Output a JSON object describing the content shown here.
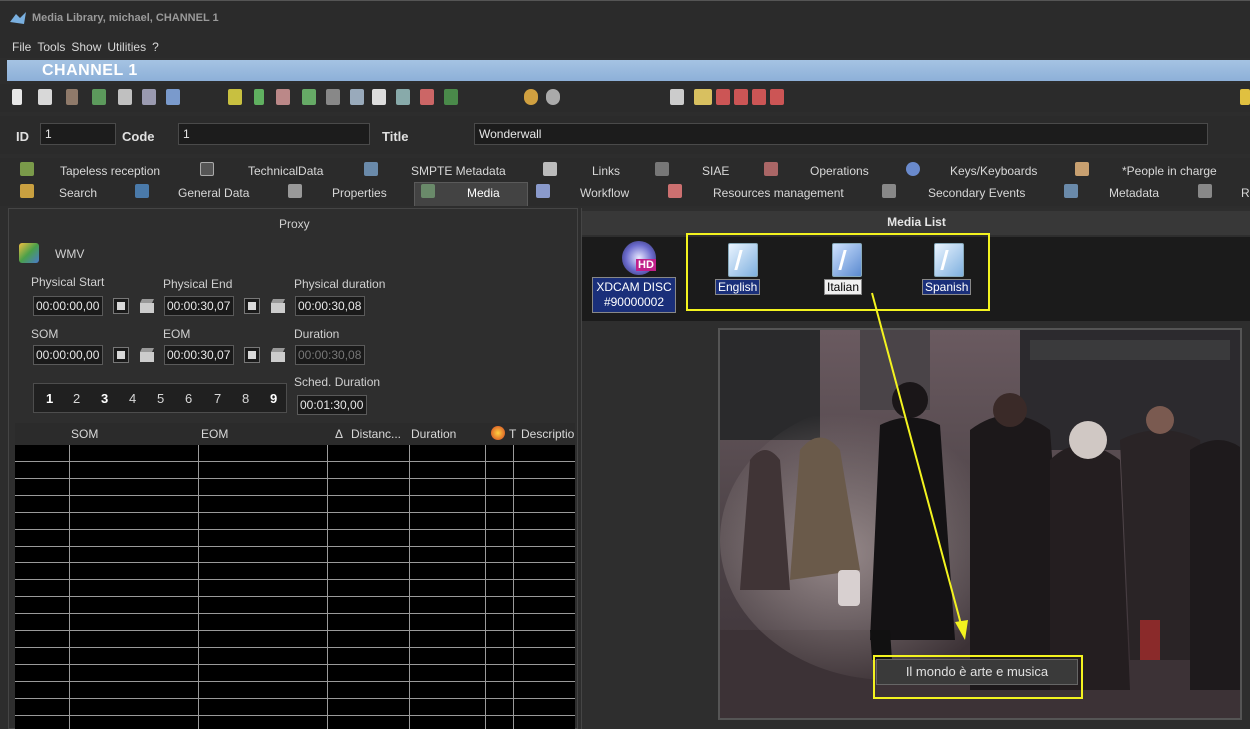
{
  "window": {
    "title": "Media Library, michael, CHANNEL 1"
  },
  "menu": [
    "File",
    "Tools",
    "Show",
    "Utilities",
    "?"
  ],
  "channel": "CHANNEL 1",
  "fields": {
    "id_label": "ID",
    "id_value": "1",
    "code_label": "Code",
    "code_value": "1",
    "title_label": "Title",
    "title_value": "Wonderwall"
  },
  "tabs_row1": [
    "Tapeless reception",
    "TechnicalData",
    "SMPTE Metadata",
    "Links",
    "SIAE",
    "Operations",
    "Keys/Keyboards",
    "*People in charge"
  ],
  "tabs_row2": [
    "Search",
    "General Data",
    "Properties",
    "Media",
    "Workflow",
    "Resources management",
    "Secondary Events",
    "Metadata",
    "R"
  ],
  "proxy": {
    "header": "Proxy",
    "format": "WMV",
    "physical_start_label": "Physical Start",
    "physical_start": "00:00:00,00",
    "physical_end_label": "Physical End",
    "physical_end": "00:00:30,07",
    "physical_duration_label": "Physical duration",
    "physical_duration": "00:00:30,08",
    "som_label": "SOM",
    "som": "00:00:00,00",
    "eom_label": "EOM",
    "eom": "00:00:30,07",
    "duration_label": "Duration",
    "duration": "00:00:30,08",
    "sched_duration_label": "Sched. Duration",
    "sched_duration": "00:01:30,00",
    "pages": [
      "1",
      "2",
      "3",
      "4",
      "5",
      "6",
      "7",
      "8",
      "9"
    ]
  },
  "grid": {
    "columns": [
      "SOM",
      "EOM",
      "Distanc...",
      "Duration",
      "T",
      "Descriptio"
    ],
    "sort_indicator": "Δ"
  },
  "media_list": {
    "header": "Media List",
    "items": [
      {
        "line1": "XDCAM DISC",
        "line2": "#90000002",
        "badge": "HD"
      },
      {
        "label": "English"
      },
      {
        "label": "Italian"
      },
      {
        "label": "Spanish"
      }
    ],
    "subtitle": "Il mondo è arte e musica"
  },
  "colors": {
    "highlight": "#f3f31f",
    "channel_bar": "#9bbde0",
    "label_bg": "#1a2f7a"
  }
}
